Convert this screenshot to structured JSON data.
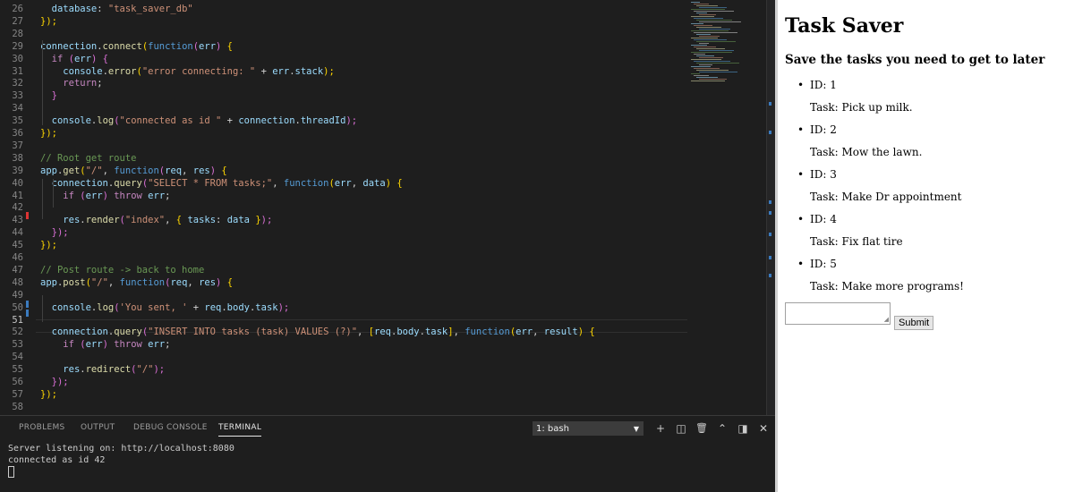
{
  "editor": {
    "lines": [
      {
        "n": "26",
        "tokens": [
          [
            "  ",
            "p"
          ],
          [
            "database",
            "var"
          ],
          [
            ": ",
            "p"
          ],
          [
            "\"task_saver_db\"",
            "str"
          ]
        ]
      },
      {
        "n": "27",
        "tokens": [
          [
            "});",
            "br"
          ]
        ]
      },
      {
        "n": "28",
        "tokens": []
      },
      {
        "n": "29",
        "tokens": [
          [
            "connection",
            "var"
          ],
          [
            ".",
            "p"
          ],
          [
            "connect",
            "fn"
          ],
          [
            "(",
            "br"
          ],
          [
            "function",
            "kw"
          ],
          [
            "(",
            "br2"
          ],
          [
            "err",
            "var"
          ],
          [
            ")",
            "br2"
          ],
          [
            " {",
            "br"
          ]
        ]
      },
      {
        "n": "30",
        "tokens": [
          [
            "  ",
            "p"
          ],
          [
            "if",
            "ctrl"
          ],
          [
            " (",
            "br2"
          ],
          [
            "err",
            "var"
          ],
          [
            ") {",
            "br2"
          ]
        ]
      },
      {
        "n": "31",
        "tokens": [
          [
            "    ",
            "p"
          ],
          [
            "console",
            "var"
          ],
          [
            ".",
            "p"
          ],
          [
            "error",
            "fn"
          ],
          [
            "(",
            "br"
          ],
          [
            "\"error connecting: \"",
            "str"
          ],
          [
            " + ",
            "p"
          ],
          [
            "err",
            "var"
          ],
          [
            ".",
            "p"
          ],
          [
            "stack",
            "var"
          ],
          [
            ");",
            "br"
          ]
        ]
      },
      {
        "n": "32",
        "tokens": [
          [
            "    ",
            "p"
          ],
          [
            "return",
            "ctrl"
          ],
          [
            ";",
            "p"
          ]
        ]
      },
      {
        "n": "33",
        "tokens": [
          [
            "  ",
            "p"
          ],
          [
            "}",
            "br2"
          ]
        ]
      },
      {
        "n": "34",
        "tokens": []
      },
      {
        "n": "35",
        "tokens": [
          [
            "  ",
            "p"
          ],
          [
            "console",
            "var"
          ],
          [
            ".",
            "p"
          ],
          [
            "log",
            "fn"
          ],
          [
            "(",
            "br2"
          ],
          [
            "\"connected as id \"",
            "str"
          ],
          [
            " + ",
            "p"
          ],
          [
            "connection",
            "var"
          ],
          [
            ".",
            "p"
          ],
          [
            "threadId",
            "var"
          ],
          [
            ");",
            "br2"
          ]
        ]
      },
      {
        "n": "36",
        "tokens": [
          [
            "});",
            "br"
          ]
        ]
      },
      {
        "n": "37",
        "tokens": []
      },
      {
        "n": "38",
        "tokens": [
          [
            "// Root get route",
            "cm"
          ]
        ]
      },
      {
        "n": "39",
        "tokens": [
          [
            "app",
            "var"
          ],
          [
            ".",
            "p"
          ],
          [
            "get",
            "fn"
          ],
          [
            "(",
            "br"
          ],
          [
            "\"/\"",
            "str"
          ],
          [
            ", ",
            "p"
          ],
          [
            "function",
            "kw"
          ],
          [
            "(",
            "br2"
          ],
          [
            "req",
            "var"
          ],
          [
            ", ",
            "p"
          ],
          [
            "res",
            "var"
          ],
          [
            ")",
            "br2"
          ],
          [
            " {",
            "br"
          ]
        ]
      },
      {
        "n": "40",
        "tokens": [
          [
            "  ",
            "p"
          ],
          [
            "connection",
            "var"
          ],
          [
            ".",
            "p"
          ],
          [
            "query",
            "fn"
          ],
          [
            "(",
            "br2"
          ],
          [
            "\"SELECT * FROM tasks;\"",
            "str"
          ],
          [
            ", ",
            "p"
          ],
          [
            "function",
            "kw"
          ],
          [
            "(",
            "br"
          ],
          [
            "err",
            "var"
          ],
          [
            ", ",
            "p"
          ],
          [
            "data",
            "var"
          ],
          [
            ")",
            "br"
          ],
          [
            " {",
            "br"
          ]
        ]
      },
      {
        "n": "41",
        "tokens": [
          [
            "    ",
            "p"
          ],
          [
            "if",
            "ctrl"
          ],
          [
            " (",
            "br2"
          ],
          [
            "err",
            "var"
          ],
          [
            ") ",
            "br2"
          ],
          [
            "throw",
            "ctrl"
          ],
          [
            " ",
            "p"
          ],
          [
            "err",
            "var"
          ],
          [
            ";",
            "p"
          ]
        ]
      },
      {
        "n": "42",
        "tokens": []
      },
      {
        "n": "43",
        "tokens": [
          [
            "    ",
            "p"
          ],
          [
            "res",
            "var"
          ],
          [
            ".",
            "p"
          ],
          [
            "render",
            "fn"
          ],
          [
            "(",
            "br2"
          ],
          [
            "\"index\"",
            "str"
          ],
          [
            ", ",
            "p"
          ],
          [
            "{ ",
            "br"
          ],
          [
            "tasks",
            "var"
          ],
          [
            ": ",
            "p"
          ],
          [
            "data",
            "var"
          ],
          [
            " }",
            "br"
          ],
          [
            ");",
            "br2"
          ]
        ]
      },
      {
        "n": "44",
        "tokens": [
          [
            "  ",
            "p"
          ],
          [
            "});",
            "br2"
          ]
        ]
      },
      {
        "n": "45",
        "tokens": [
          [
            "});",
            "br"
          ]
        ]
      },
      {
        "n": "46",
        "tokens": []
      },
      {
        "n": "47",
        "tokens": [
          [
            "// Post route -> back to home",
            "cm"
          ]
        ]
      },
      {
        "n": "48",
        "tokens": [
          [
            "app",
            "var"
          ],
          [
            ".",
            "p"
          ],
          [
            "post",
            "fn"
          ],
          [
            "(",
            "br"
          ],
          [
            "\"/\"",
            "str"
          ],
          [
            ", ",
            "p"
          ],
          [
            "function",
            "kw"
          ],
          [
            "(",
            "br2"
          ],
          [
            "req",
            "var"
          ],
          [
            ", ",
            "p"
          ],
          [
            "res",
            "var"
          ],
          [
            ")",
            "br2"
          ],
          [
            " {",
            "br"
          ]
        ]
      },
      {
        "n": "49",
        "tokens": []
      },
      {
        "n": "50",
        "tokens": [
          [
            "  ",
            "p"
          ],
          [
            "console",
            "var"
          ],
          [
            ".",
            "p"
          ],
          [
            "log",
            "fn"
          ],
          [
            "(",
            "br2"
          ],
          [
            "'You sent, '",
            "str"
          ],
          [
            " + ",
            "p"
          ],
          [
            "req",
            "var"
          ],
          [
            ".",
            "p"
          ],
          [
            "body",
            "var"
          ],
          [
            ".",
            "p"
          ],
          [
            "task",
            "var"
          ],
          [
            ");",
            "br2"
          ]
        ]
      },
      {
        "n": "51",
        "tokens": []
      },
      {
        "n": "52",
        "tokens": [
          [
            "  ",
            "p"
          ],
          [
            "connection",
            "var"
          ],
          [
            ".",
            "p"
          ],
          [
            "query",
            "fn"
          ],
          [
            "(",
            "br2"
          ],
          [
            "\"INSERT INTO tasks (task) VALUES (?)\"",
            "str"
          ],
          [
            ", ",
            "p"
          ],
          [
            "[",
            "br"
          ],
          [
            "req",
            "var"
          ],
          [
            ".",
            "p"
          ],
          [
            "body",
            "var"
          ],
          [
            ".",
            "p"
          ],
          [
            "task",
            "var"
          ],
          [
            "]",
            "br"
          ],
          [
            ", ",
            "p"
          ],
          [
            "function",
            "kw"
          ],
          [
            "(",
            "br"
          ],
          [
            "err",
            "var"
          ],
          [
            ", ",
            "p"
          ],
          [
            "result",
            "var"
          ],
          [
            ")",
            "br"
          ],
          [
            " {",
            "br"
          ]
        ]
      },
      {
        "n": "53",
        "tokens": [
          [
            "    ",
            "p"
          ],
          [
            "if",
            "ctrl"
          ],
          [
            " (",
            "br2"
          ],
          [
            "err",
            "var"
          ],
          [
            ") ",
            "br2"
          ],
          [
            "throw",
            "ctrl"
          ],
          [
            " ",
            "p"
          ],
          [
            "err",
            "var"
          ],
          [
            ";",
            "p"
          ]
        ]
      },
      {
        "n": "54",
        "tokens": []
      },
      {
        "n": "55",
        "tokens": [
          [
            "    ",
            "p"
          ],
          [
            "res",
            "var"
          ],
          [
            ".",
            "p"
          ],
          [
            "redirect",
            "fn"
          ],
          [
            "(",
            "br2"
          ],
          [
            "\"/\"",
            "str"
          ],
          [
            ");",
            "br2"
          ]
        ]
      },
      {
        "n": "56",
        "tokens": [
          [
            "  ",
            "p"
          ],
          [
            "});",
            "br2"
          ]
        ]
      },
      {
        "n": "57",
        "tokens": [
          [
            "});",
            "br"
          ]
        ]
      },
      {
        "n": "58",
        "tokens": []
      }
    ],
    "current_line": "51"
  },
  "panel": {
    "tabs": [
      "PROBLEMS",
      "OUTPUT",
      "DEBUG CONSOLE",
      "TERMINAL"
    ],
    "active_tab": "TERMINAL",
    "terminal_select": "1: bash",
    "toolbar_icons": [
      "plus-icon",
      "split-terminal-icon",
      "trash-icon",
      "chevron-up-icon",
      "maximize-panel-icon",
      "close-icon"
    ],
    "terminal_lines": [
      "Server listening on: http://localhost:8080",
      "connected as id 42"
    ]
  },
  "browser": {
    "title": "Task Saver",
    "subtitle": "Save the tasks you need to get to later",
    "tasks": [
      {
        "id": "ID: 1",
        "task": "Task: Pick up milk."
      },
      {
        "id": "ID: 2",
        "task": "Task: Mow the lawn."
      },
      {
        "id": "ID: 3",
        "task": "Task: Make Dr appointment"
      },
      {
        "id": "ID: 4",
        "task": "Task: Fix flat tire"
      },
      {
        "id": "ID: 5",
        "task": "Task: Make more programs!"
      }
    ],
    "task_input_value": "",
    "submit_label": "Submit"
  },
  "colors": {
    "editor_bg": "#1e1e1e",
    "keyword": "#569cd6",
    "string": "#ce9178",
    "variable": "#9cdcfe",
    "function": "#dcdcaa",
    "comment": "#6a9955",
    "bracket_gold": "#ffd700",
    "bracket_violet": "#da70d6",
    "control": "#c586c0",
    "page_bg": "#ffffff"
  }
}
